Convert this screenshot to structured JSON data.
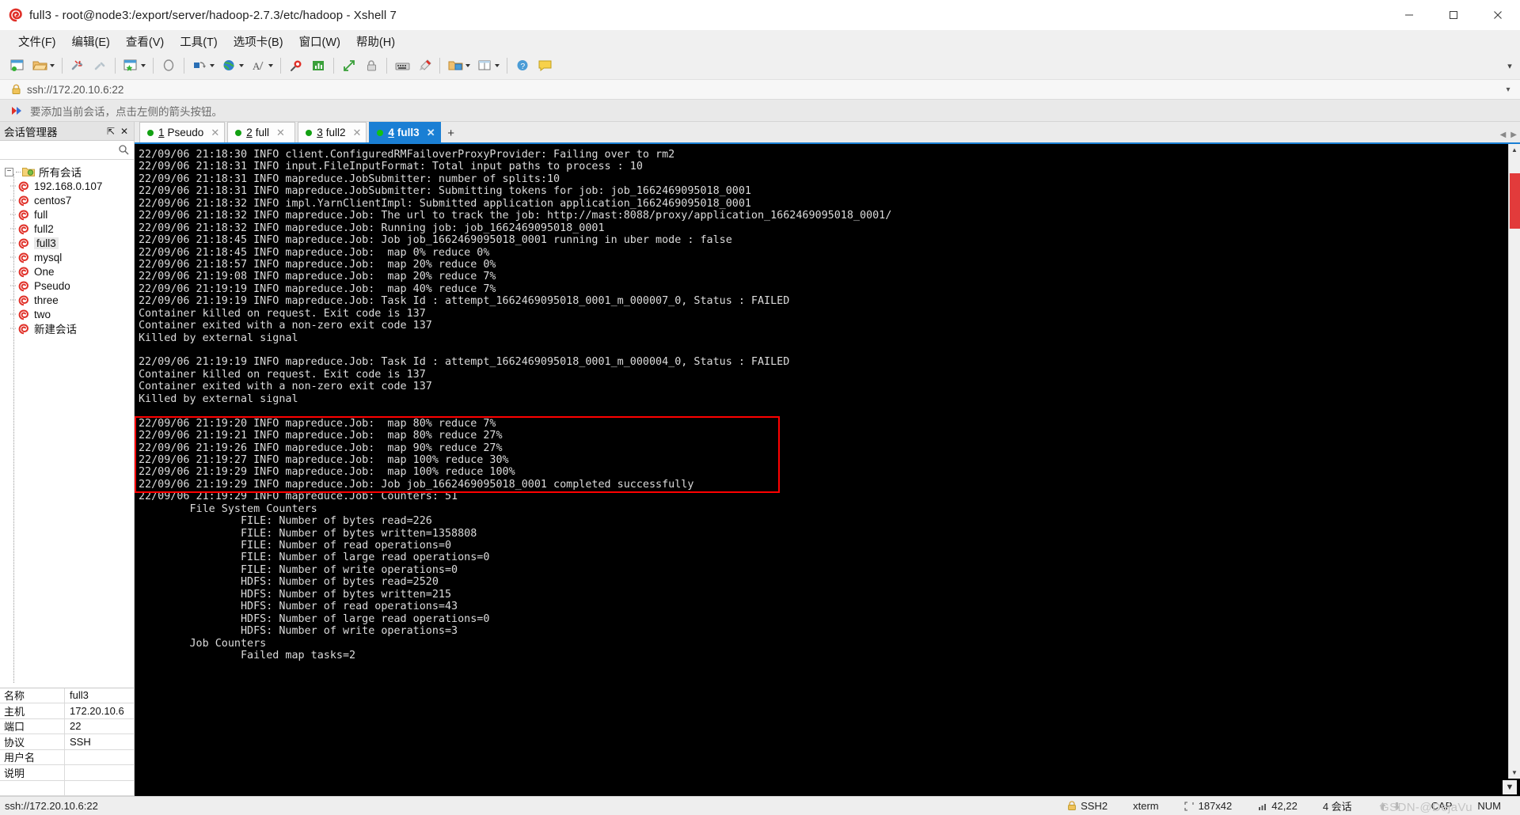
{
  "window": {
    "title": "full3 - root@node3:/export/server/hadoop-2.7.3/etc/hadoop - Xshell 7",
    "app_icon": "xshell-spiral-icon",
    "minimize_label": "—",
    "maximize_label": "▢",
    "close_label": "✕"
  },
  "menu": [
    {
      "label": "文件(F)",
      "name": "menu-file"
    },
    {
      "label": "编辑(E)",
      "name": "menu-edit"
    },
    {
      "label": "查看(V)",
      "name": "menu-view"
    },
    {
      "label": "工具(T)",
      "name": "menu-tools"
    },
    {
      "label": "选项卡(B)",
      "name": "menu-tab"
    },
    {
      "label": "窗口(W)",
      "name": "menu-window"
    },
    {
      "label": "帮助(H)",
      "name": "menu-help"
    }
  ],
  "toolbar": {
    "collapse_label": "▾",
    "buttons": [
      {
        "name": "new-session-icon",
        "title": "新建"
      },
      {
        "name": "open-folder-icon",
        "title": "打开"
      },
      {
        "name": "disconnect-icon",
        "title": "断开"
      },
      {
        "name": "reconnect-icon",
        "title": "重新连接"
      },
      {
        "name": "save-session-icon",
        "title": "保存"
      },
      {
        "name": "clear-screen-icon",
        "title": "清屏"
      },
      {
        "name": "transfer-icon",
        "title": "传输"
      },
      {
        "name": "globe-icon",
        "title": "浏览器"
      },
      {
        "name": "font-icon",
        "title": "字体"
      },
      {
        "name": "find-icon",
        "title": "查找"
      },
      {
        "name": "log-icon",
        "title": "日志"
      },
      {
        "name": "fullscreen-icon",
        "title": "全屏"
      },
      {
        "name": "lock-icon",
        "title": "锁定"
      },
      {
        "name": "keyboard-icon",
        "title": "键盘"
      },
      {
        "name": "highlight-icon",
        "title": "高亮"
      },
      {
        "name": "folder-open-icon",
        "title": "文件夹"
      },
      {
        "name": "layout-icon",
        "title": "布局"
      },
      {
        "name": "help-icon",
        "title": "帮助"
      },
      {
        "name": "chat-icon",
        "title": "聊天"
      }
    ]
  },
  "address_bar": {
    "value": "ssh://172.20.10.6:22",
    "lock_icon": "lock-icon",
    "dropdown_label": "▾"
  },
  "notice": {
    "icon": "red-arrow-icon",
    "text": "要添加当前会话，点击左侧的箭头按钮。"
  },
  "session_manager": {
    "title": "会话管理器",
    "pin_label": "⇱",
    "close_label": "✕",
    "search_placeholder": "",
    "search_value": "",
    "search_icon": "search-icon",
    "root": {
      "label": "所有会话",
      "icon": "folder-icon",
      "expander": "−"
    },
    "items": [
      {
        "label": "192.168.0.107",
        "icon": "session-icon",
        "selected": false
      },
      {
        "label": "centos7",
        "icon": "session-icon",
        "selected": false
      },
      {
        "label": "full",
        "icon": "session-icon",
        "selected": false
      },
      {
        "label": "full2",
        "icon": "session-icon",
        "selected": false
      },
      {
        "label": "full3",
        "icon": "session-icon",
        "selected": true
      },
      {
        "label": "mysql",
        "icon": "session-icon",
        "selected": false
      },
      {
        "label": "One",
        "icon": "session-icon",
        "selected": false
      },
      {
        "label": "Pseudo",
        "icon": "session-icon",
        "selected": false
      },
      {
        "label": "three",
        "icon": "session-icon",
        "selected": false
      },
      {
        "label": "two",
        "icon": "session-icon",
        "selected": false
      },
      {
        "label": "新建会话",
        "icon": "session-icon",
        "selected": false
      }
    ],
    "properties": [
      {
        "key": "名称",
        "value": "full3"
      },
      {
        "key": "主机",
        "value": "172.20.10.6"
      },
      {
        "key": "端口",
        "value": "22"
      },
      {
        "key": "协议",
        "value": "SSH"
      },
      {
        "key": "用户名",
        "value": ""
      },
      {
        "key": "说明",
        "value": ""
      },
      {
        "key": "",
        "value": ""
      }
    ]
  },
  "tabs": {
    "add_label": "+",
    "nav_left": "◀",
    "nav_right": "▶",
    "items": [
      {
        "num": "1",
        "label": "Pseudo",
        "active": false,
        "close": "✕",
        "status": "connected"
      },
      {
        "num": "2",
        "label": "full",
        "active": false,
        "close": "✕",
        "status": "connected"
      },
      {
        "num": "3",
        "label": "full2",
        "active": false,
        "close": "✕",
        "status": "connected"
      },
      {
        "num": "4",
        "label": "full3",
        "active": true,
        "close": "✕",
        "status": "connected"
      }
    ]
  },
  "terminal": {
    "background": "#000000",
    "foreground": "#dcdcdc",
    "highlight_color": "#ff0000",
    "highlight_start_line": 22,
    "highlight_line_count": 6,
    "lines": [
      "22/09/06 21:18:30 INFO client.ConfiguredRMFailoverProxyProvider: Failing over to rm2",
      "22/09/06 21:18:31 INFO input.FileInputFormat: Total input paths to process : 10",
      "22/09/06 21:18:31 INFO mapreduce.JobSubmitter: number of splits:10",
      "22/09/06 21:18:31 INFO mapreduce.JobSubmitter: Submitting tokens for job: job_1662469095018_0001",
      "22/09/06 21:18:32 INFO impl.YarnClientImpl: Submitted application application_1662469095018_0001",
      "22/09/06 21:18:32 INFO mapreduce.Job: The url to track the job: http://mast:8088/proxy/application_1662469095018_0001/",
      "22/09/06 21:18:32 INFO mapreduce.Job: Running job: job_1662469095018_0001",
      "22/09/06 21:18:45 INFO mapreduce.Job: Job job_1662469095018_0001 running in uber mode : false",
      "22/09/06 21:18:45 INFO mapreduce.Job:  map 0% reduce 0%",
      "22/09/06 21:18:57 INFO mapreduce.Job:  map 20% reduce 0%",
      "22/09/06 21:19:08 INFO mapreduce.Job:  map 20% reduce 7%",
      "22/09/06 21:19:19 INFO mapreduce.Job:  map 40% reduce 7%",
      "22/09/06 21:19:19 INFO mapreduce.Job: Task Id : attempt_1662469095018_0001_m_000007_0, Status : FAILED",
      "Container killed on request. Exit code is 137",
      "Container exited with a non-zero exit code 137",
      "Killed by external signal",
      "",
      "22/09/06 21:19:19 INFO mapreduce.Job: Task Id : attempt_1662469095018_0001_m_000004_0, Status : FAILED",
      "Container killed on request. Exit code is 137",
      "Container exited with a non-zero exit code 137",
      "Killed by external signal",
      "",
      "22/09/06 21:19:20 INFO mapreduce.Job:  map 80% reduce 7%",
      "22/09/06 21:19:21 INFO mapreduce.Job:  map 80% reduce 27%",
      "22/09/06 21:19:26 INFO mapreduce.Job:  map 90% reduce 27%",
      "22/09/06 21:19:27 INFO mapreduce.Job:  map 100% reduce 30%",
      "22/09/06 21:19:29 INFO mapreduce.Job:  map 100% reduce 100%",
      "22/09/06 21:19:29 INFO mapreduce.Job: Job job_1662469095018_0001 completed successfully",
      "22/09/06 21:19:29 INFO mapreduce.Job: Counters: 51",
      "        File System Counters",
      "                FILE: Number of bytes read=226",
      "                FILE: Number of bytes written=1358808",
      "                FILE: Number of read operations=0",
      "                FILE: Number of large read operations=0",
      "                FILE: Number of write operations=0",
      "                HDFS: Number of bytes read=2520",
      "                HDFS: Number of bytes written=215",
      "                HDFS: Number of read operations=43",
      "                HDFS: Number of large read operations=0",
      "                HDFS: Number of write operations=3",
      "        Job Counters",
      "                Failed map tasks=2"
    ]
  },
  "status_bar": {
    "connection": "ssh://172.20.10.6:22",
    "protocol_icon": "lock-icon",
    "protocol": "SSH2",
    "term_type": "xterm",
    "size_icon": "size-icon",
    "size": "187x42",
    "cursor_icon": "cursor-icon",
    "cursor": "42,22",
    "sessions": "4 会话",
    "up_icon": "arrow-up-icon",
    "down_icon": "arrow-down-icon",
    "cap": "CAP",
    "num": "NUM",
    "watermark": "GSDN-@DejaVu"
  }
}
